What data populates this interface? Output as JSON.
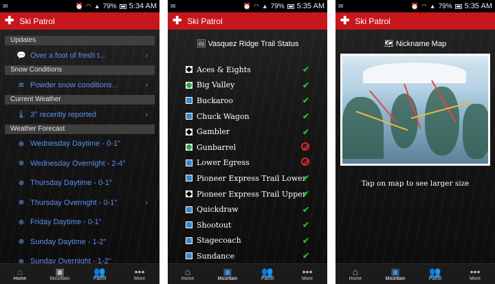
{
  "status": {
    "battery": "79%",
    "time_1": "5:34 AM",
    "time_2": "5:35 AM",
    "time_3": "5:35 AM"
  },
  "app": {
    "title": "Ski Patrol"
  },
  "home": {
    "sections": [
      {
        "header": "Updates",
        "rows": [
          {
            "icon": "chat-bubble-icon",
            "text": "Over a foot of fresh t...",
            "chevron": true
          }
        ]
      },
      {
        "header": "Snow Conditions",
        "rows": [
          {
            "icon": "layers-icon",
            "text": "Powder snow conditions...",
            "chevron": true
          }
        ]
      },
      {
        "header": "Current Weather",
        "rows": [
          {
            "icon": "thermometer-icon",
            "text": "3° recently reported",
            "chevron": true
          }
        ]
      }
    ],
    "forecast_header": "Weather Forecast",
    "forecast": [
      "Wednesday Daytime - 0-1\"",
      "Wednesday Overnight - 2-4\"",
      "Thursday Daytime - 0-1\"",
      "Thursday Overnight - 0-1\"",
      "Friday Daytime - 0-1\"",
      "Sunday Daytime - 1-2\"",
      "Sunday Overnight - 1-2\""
    ]
  },
  "trails": {
    "title": "Vasquez Ridge Trail Status",
    "items": [
      {
        "name": "Aces & Eights",
        "marker": "double-diamond",
        "status": "open"
      },
      {
        "name": "Big Valley",
        "marker": "green-circle",
        "status": "open"
      },
      {
        "name": "Buckaroo",
        "marker": "blue-square",
        "status": "open"
      },
      {
        "name": "Chuck Wagon",
        "marker": "blue-square",
        "status": "open"
      },
      {
        "name": "Gambler",
        "marker": "double-diamond",
        "status": "open"
      },
      {
        "name": "Gunbarrel",
        "marker": "green-circle",
        "status": "closed"
      },
      {
        "name": "Lower Egress",
        "marker": "blue-square",
        "status": "closed"
      },
      {
        "name": "Pioneer Express Trail Lower",
        "marker": "blue-square",
        "status": "open"
      },
      {
        "name": "Pioneer Express Trail Upper",
        "marker": "double-diamond",
        "status": "open"
      },
      {
        "name": "Quickdraw",
        "marker": "blue-square",
        "status": "open"
      },
      {
        "name": "Shootout",
        "marker": "blue-square",
        "status": "open"
      },
      {
        "name": "Stagecoach",
        "marker": "blue-square",
        "status": "open"
      },
      {
        "name": "Sundance",
        "marker": "blue-square",
        "status": "open"
      }
    ]
  },
  "map": {
    "title": "Nickname Map",
    "caption": "Tap on map to see larger size"
  },
  "nav": [
    {
      "label": "Home",
      "icon": "home-icon"
    },
    {
      "label": "Mountain",
      "icon": "image-icon"
    },
    {
      "label": "Patrol",
      "icon": "people-icon"
    },
    {
      "label": "More",
      "icon": "more-icon"
    }
  ],
  "colors": {
    "appbar": "#c8161d",
    "link": "#5c8ff0",
    "open": "#28b82f",
    "closed": "#e12727"
  }
}
